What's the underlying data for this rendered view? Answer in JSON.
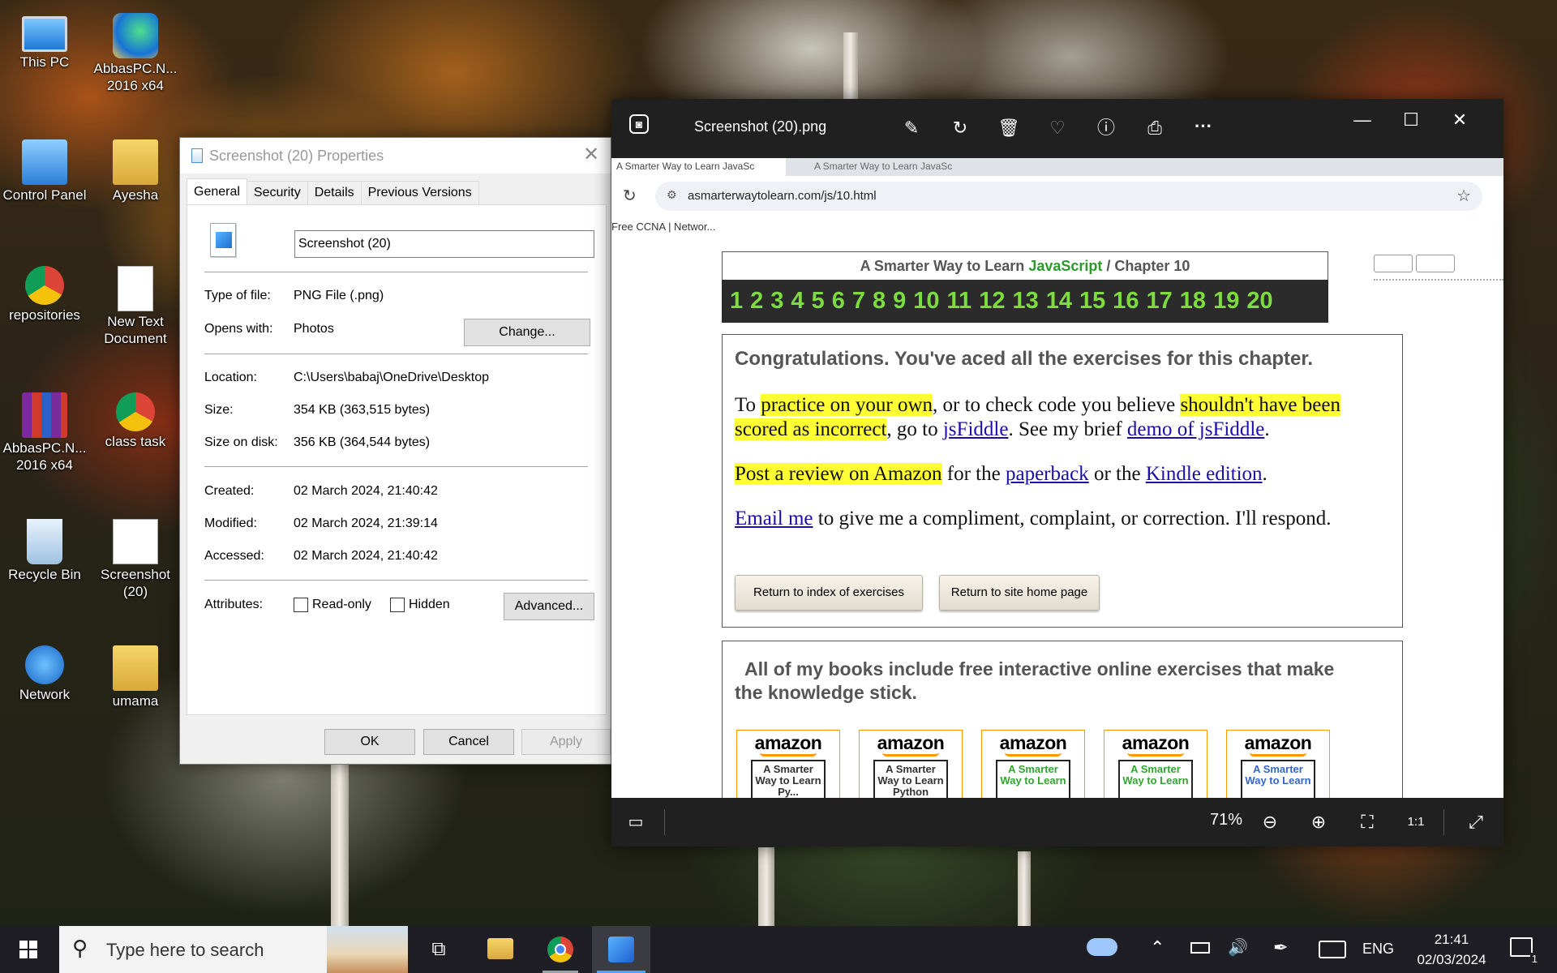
{
  "desktop": {
    "icons": [
      {
        "label": "This PC",
        "icon": "monitor-icon"
      },
      {
        "label": "AbbasPC.N...\n2016 x64",
        "icon": "edge-icon"
      },
      {
        "label": "Control Panel",
        "icon": "control-panel-icon"
      },
      {
        "label": "Ayesha",
        "icon": "folder-icon"
      },
      {
        "label": "repositories",
        "icon": "chrome-shortcut-icon"
      },
      {
        "label": "New Text\nDocument",
        "icon": "text-file-icon"
      },
      {
        "label": "AbbasPC.N...\n2016 x64",
        "icon": "winrar-icon"
      },
      {
        "label": "class task",
        "icon": "chrome-shortcut-icon"
      },
      {
        "label": "Recycle Bin",
        "icon": "recycle-bin-icon"
      },
      {
        "label": "Screenshot\n(20)",
        "icon": "image-file-icon"
      },
      {
        "label": "Network",
        "icon": "network-icon"
      },
      {
        "label": "umama",
        "icon": "folder-icon"
      }
    ]
  },
  "properties": {
    "title": "Screenshot (20) Properties",
    "tabs": [
      "General",
      "Security",
      "Details",
      "Previous Versions"
    ],
    "filename": "Screenshot (20)",
    "type_label": "Type of file:",
    "type_value": "PNG File (.png)",
    "opens_label": "Opens with:",
    "opens_value": "Photos",
    "change_button": "Change...",
    "location_label": "Location:",
    "location_value": "C:\\Users\\babaj\\OneDrive\\Desktop",
    "size_label": "Size:",
    "size_value": "354 KB (363,515 bytes)",
    "size_disk_label": "Size on disk:",
    "size_disk_value": "356 KB (364,544 bytes)",
    "created_label": "Created:",
    "created_value": "02 March 2024, 21:40:42",
    "modified_label": "Modified:",
    "modified_value": "02 March 2024, 21:39:14",
    "accessed_label": "Accessed:",
    "accessed_value": "02 March 2024, 21:40:42",
    "attributes_label": "Attributes:",
    "readonly_label": "Read-only",
    "hidden_label": "Hidden",
    "advanced_button": "Advanced...",
    "ok_button": "OK",
    "cancel_button": "Cancel",
    "apply_button": "Apply"
  },
  "viewer": {
    "filename": "Screenshot (20).png",
    "zoom": "71%",
    "browser": {
      "tab1": "A Smarter Way to Learn JavaSc",
      "tab2": "A Smarter Way to Learn JavaSc",
      "url": "asmarterwaytolearn.com/js/10.html",
      "bookmark": "Free CCNA | Networ..."
    },
    "page": {
      "header_prefix": "A Smarter Way to Learn ",
      "header_js": "JavaScript",
      "header_suffix": "  /  Chapter 10",
      "chapters": [
        "1",
        "2",
        "3",
        "4",
        "5",
        "6",
        "7",
        "8",
        "9",
        "10",
        "11",
        "12",
        "13",
        "14",
        "15",
        "16",
        "17",
        "18",
        "19",
        "20"
      ],
      "congrats": "Congratulations. You've aced all the exercises for this chapter.",
      "p1_a": "To ",
      "p1_hl1": "practice on your own",
      "p1_b": ", or to check code you believe ",
      "p1_hl2": "shouldn't have been scored as incorrect",
      "p1_c": ", go to ",
      "p1_link1": "jsFiddle",
      "p1_d": ". See my brief ",
      "p1_link2": "demo of jsFiddle",
      "p1_e": ".",
      "p2_hl": "Post a review on Amazon",
      "p2_a": " for the ",
      "p2_link1": "paperback",
      "p2_b": " or the ",
      "p2_link2": "Kindle edition",
      "p2_c": ".",
      "p3_link": "Email me",
      "p3_text": " to give me a compliment, complaint, or correction. I'll respond.",
      "btn_index": "Return to index of exercises",
      "btn_home": "Return to site home page",
      "books_heading": "All of my books include free interactive online exercises that make the knowledge stick.",
      "books": [
        {
          "brand": "amazon",
          "cover": "A Smarter Way to Learn Py...",
          "color": "#333333"
        },
        {
          "brand": "amazon",
          "cover": "A Smarter Way to Learn Python",
          "color": "#333333"
        },
        {
          "brand": "amazon",
          "cover": "A Smarter Way to Learn",
          "color": "#2fa52f"
        },
        {
          "brand": "amazon",
          "cover": "A Smarter Way to Learn",
          "color": "#2fa52f"
        },
        {
          "brand": "amazon",
          "cover": "A Smarter Way to Learn",
          "color": "#3366cc"
        }
      ]
    }
  },
  "taskbar": {
    "search_placeholder": "Type here to search",
    "language": "ENG",
    "time": "21:41",
    "date": "02/03/2024",
    "notifications": "1"
  }
}
